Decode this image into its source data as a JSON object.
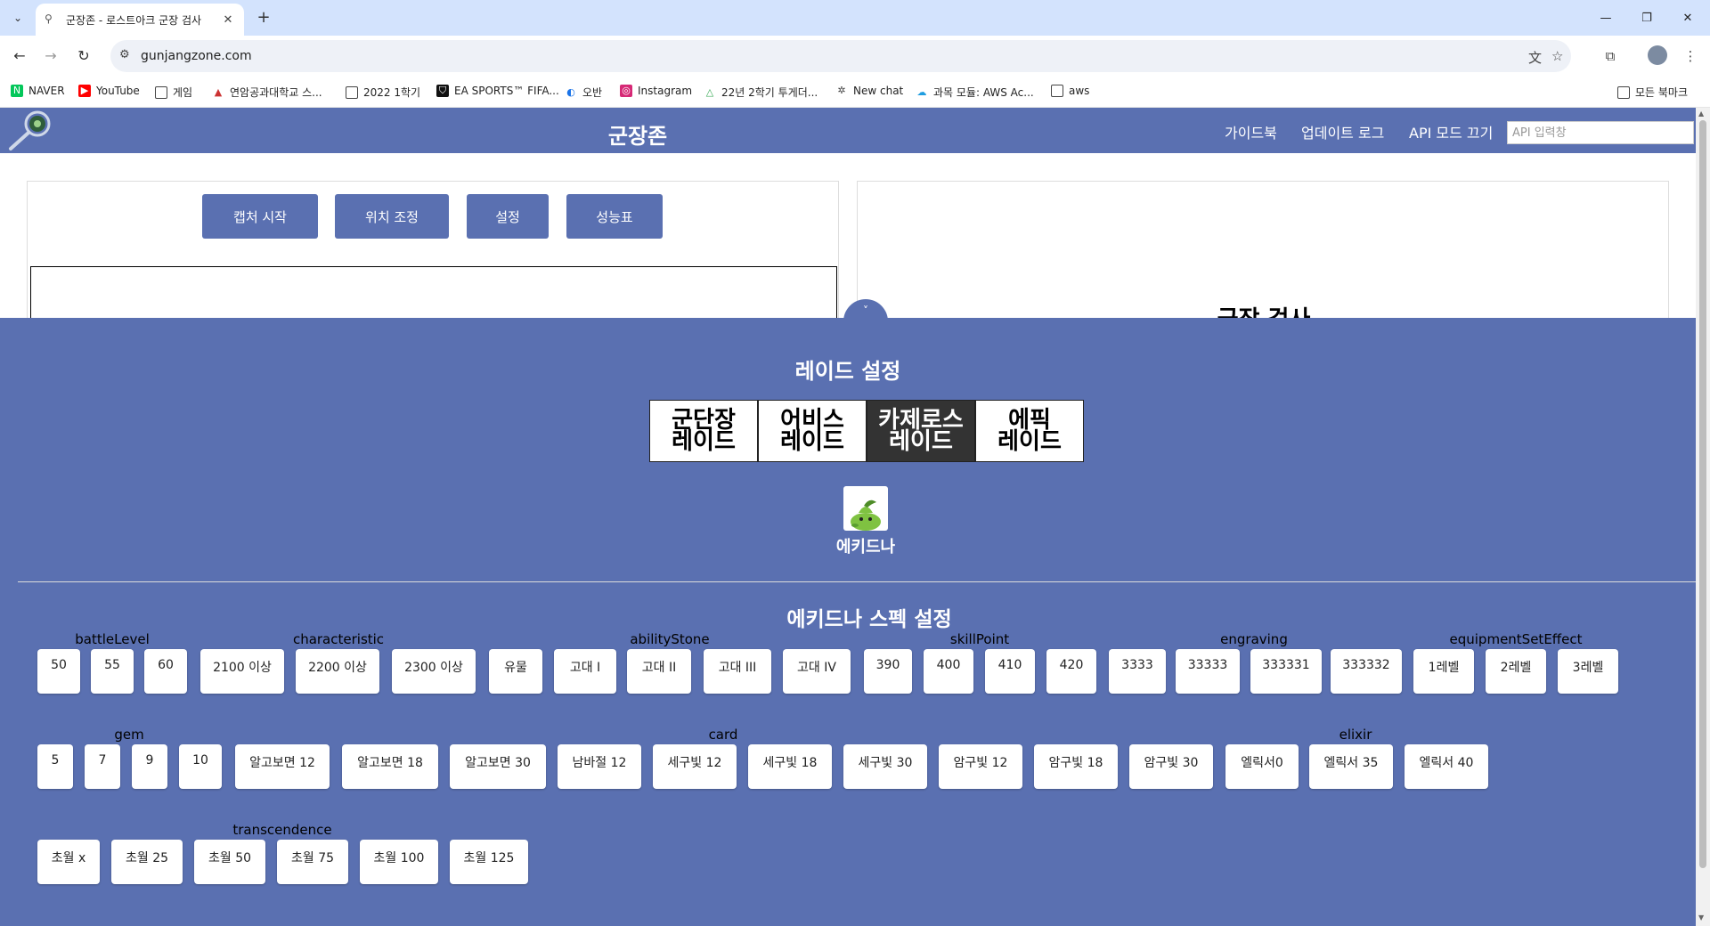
{
  "browser": {
    "tab_title": "군장존 - 로스트아크 군장 검사",
    "url": "gunjangzone.com",
    "bookmarks": [
      "NAVER",
      "YouTube",
      "게임",
      "연암공과대학교 스...",
      "2022 1학기",
      "EA SPORTS™ FIFA...",
      "오반",
      "Instagram",
      "22년 2학기 투게더...",
      "New chat",
      "과목 모듈: AWS Ac...",
      "aws"
    ],
    "all_bookmarks": "모든 북마크"
  },
  "site": {
    "title": "군장존",
    "nav": [
      "가이드북",
      "업데이트 로그",
      "API 모드 끄기"
    ],
    "api_placeholder": "API 입력창"
  },
  "actions": [
    "캡처 시작",
    "위치 조정",
    "설정",
    "성능표"
  ],
  "inspect_title": "군장 검사",
  "toggle_glyph": "˅",
  "raid": {
    "heading": "레이드 설정",
    "tabs": [
      {
        "line1": "군단장",
        "line2": "레이드"
      },
      {
        "line1": "어비스",
        "line2": "레이드"
      },
      {
        "line1": "카제로스",
        "line2": "레이드"
      },
      {
        "line1": "에픽",
        "line2": "레이드"
      }
    ],
    "active_tab": 2,
    "boss_name": "에키드나"
  },
  "spec": {
    "heading": "에키드나 스펙 설정",
    "groups": [
      {
        "label": "battleLevel",
        "options": [
          "50",
          "55",
          "60"
        ]
      },
      {
        "label": "characteristic",
        "options": [
          "2100 이상",
          "2200 이상",
          "2300 이상"
        ]
      },
      {
        "label": "abilityStone",
        "options": [
          "유물",
          "고대 I",
          "고대 II",
          "고대 III",
          "고대 IV"
        ]
      },
      {
        "label": "skillPoint",
        "options": [
          "390",
          "400",
          "410",
          "420"
        ]
      },
      {
        "label": "engraving",
        "options": [
          "3333",
          "33333",
          "333331",
          "333332"
        ]
      },
      {
        "label": "equipmentSetEffect",
        "options": [
          "1레벨",
          "2레벨",
          "3레벨"
        ]
      },
      {
        "label": "gem",
        "options": [
          "5",
          "7",
          "9",
          "10"
        ]
      },
      {
        "label": "card",
        "options": [
          "알고보면 12",
          "알고보면 18",
          "알고보면 30",
          "남바절 12",
          "세구빛 12",
          "세구빛 18",
          "세구빛 30",
          "암구빛 12",
          "암구빛 18",
          "암구빛 30"
        ]
      },
      {
        "label": "elixir",
        "options": [
          "엘릭서0",
          "엘릭서 35",
          "엘릭서 40"
        ]
      },
      {
        "label": "transcendence",
        "options": [
          "초월 x",
          "초월 25",
          "초월 50",
          "초월 75",
          "초월 100",
          "초월 125"
        ]
      }
    ]
  },
  "colors": {
    "brand": "#5a70b1",
    "active_tab": "#333333"
  }
}
